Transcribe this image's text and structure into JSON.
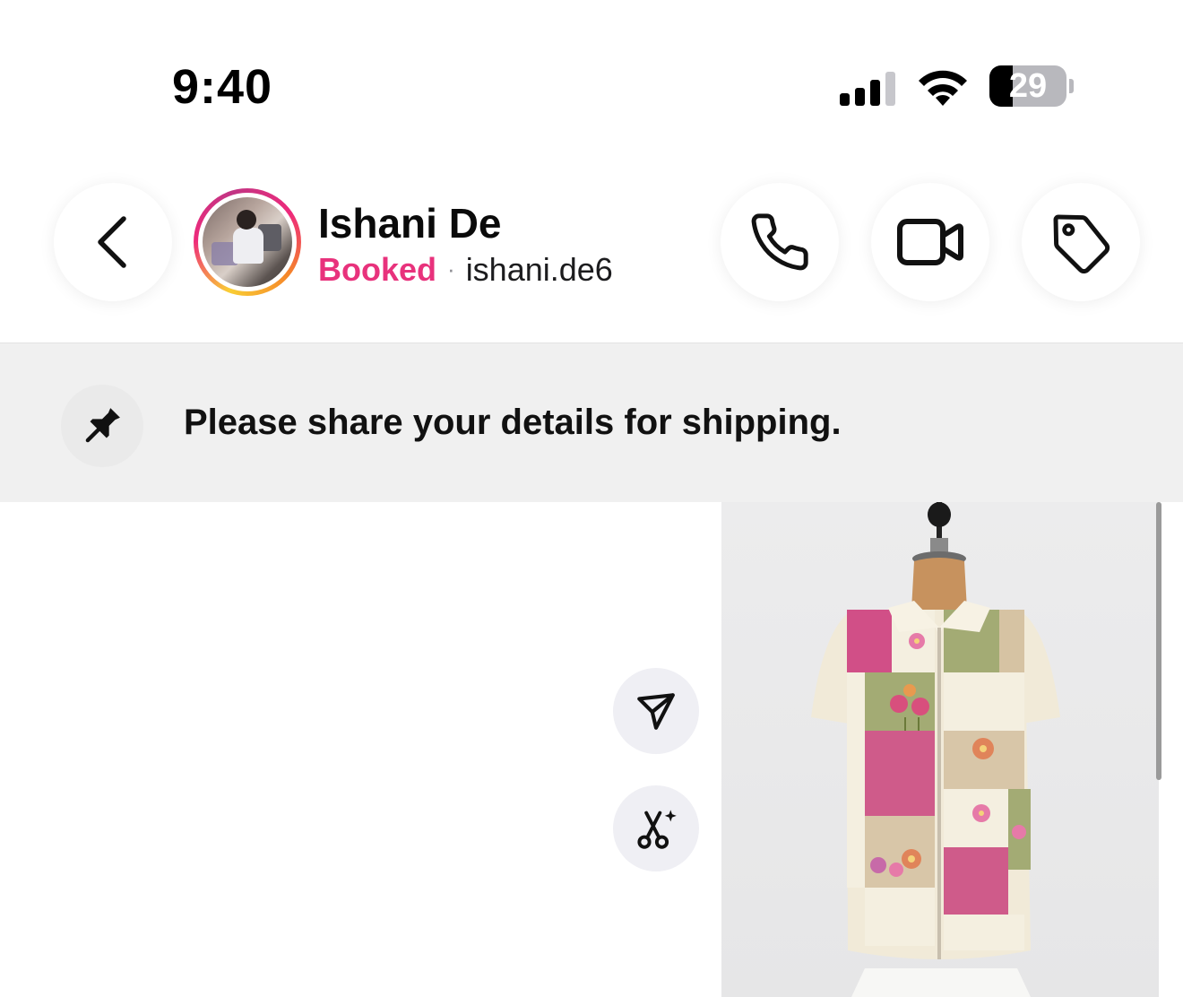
{
  "status_bar": {
    "time": "9:40",
    "battery_percent": "29",
    "icons": [
      "cellular-signal-icon",
      "wifi-icon",
      "battery-icon"
    ]
  },
  "header": {
    "back_icon": "chevron-left-icon",
    "contact": {
      "name": "Ishani De",
      "status": "Booked",
      "separator": "·",
      "username": "ishani.de6"
    },
    "actions": [
      "phone-icon",
      "video-camera-icon",
      "tag-icon"
    ]
  },
  "pinned": {
    "icon": "pin-icon",
    "text": "Please share your details for shipping."
  },
  "chat": {
    "side_actions": [
      "share-icon",
      "remix-icon"
    ]
  },
  "colors": {
    "status_accent": "#e8327c",
    "pinned_background": "#f0f0f0",
    "action_button_background": "#efeff4"
  }
}
